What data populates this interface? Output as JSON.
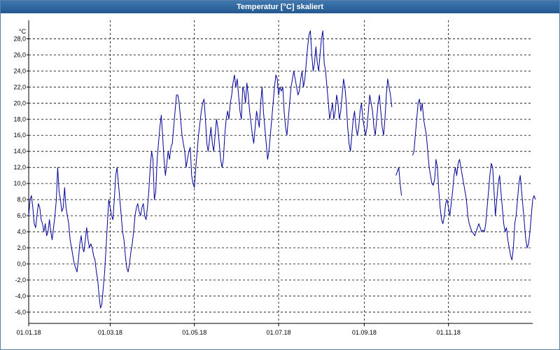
{
  "window": {
    "title": "Temperatur [°C] skaliert"
  },
  "chart_data": {
    "type": "line",
    "title": "Temperatur [°C] skaliert",
    "ylabel": "°C",
    "xlabel": "",
    "ylim": [
      -7.4,
      30.3
    ],
    "xlim": [
      0,
      365
    ],
    "grid": true,
    "legend": "none",
    "y_ticks": [
      "-6,0",
      "-4,0",
      "-2,0",
      "0,0",
      "2,0",
      "4,0",
      "6,0",
      "8,0",
      "10,0",
      "12,0",
      "14,0",
      "16,0",
      "18,0",
      "20,0",
      "22,0",
      "24,0",
      "26,0",
      "28,0"
    ],
    "x_ticks": [
      "01.01.18",
      "01.03.18",
      "01.05.18",
      "01.07.18",
      "01.09.18",
      "01.11.18"
    ],
    "series": [
      {
        "color": "#000099",
        "segments": [
          {
            "x_start": "01.01.18",
            "values": [
              6.0,
              8.0,
              8.5,
              7.0,
              5.0,
              4.5,
              6.0,
              7.5,
              7.0,
              5.5,
              5.0,
              4.0,
              5.0,
              3.5,
              4.0,
              5.5,
              4.0,
              3.0,
              4.5,
              6.0,
              8.0,
              12.0,
              9.0,
              8.0,
              6.5,
              7.0,
              9.5,
              7.0,
              6.0,
              5.0,
              3.0,
              2.0,
              1.0,
              0.0,
              -0.5,
              -1.0,
              0.5,
              2.5,
              3.5,
              2.0,
              1.5,
              3.0,
              4.5,
              3.0,
              2.0,
              2.5,
              2.0,
              1.0,
              0.5,
              -1.0,
              -2.0,
              -4.0,
              -5.5,
              -5.0,
              -3.0,
              -1.0,
              2.0,
              5.0,
              8.0,
              7.0,
              6.0,
              5.5,
              8.0,
              11.0,
              12.0,
              10.0,
              8.0,
              6.0,
              4.0,
              3.0,
              1.0,
              -0.5,
              -1.0,
              0.0,
              1.5,
              2.5,
              4.0,
              6.0,
              7.0,
              7.5,
              6.5,
              6.0,
              7.0,
              7.5,
              6.0,
              5.5,
              7.0,
              9.0,
              12.0,
              14.0,
              13.0,
              8.0,
              9.0,
              13.0,
              15.0,
              17.0,
              18.5,
              16.0,
              13.0,
              11.0,
              12.5,
              14.0,
              13.0,
              14.5,
              15.0,
              17.0,
              19.0,
              21.0,
              21.0,
              20.0,
              18.0,
              16.0,
              15.0,
              14.0,
              12.0,
              13.0,
              14.0,
              14.5,
              11.0,
              10.0,
              9.5,
              12.0,
              14.0,
              16.0,
              17.5,
              19.0,
              20.0,
              20.5,
              18.0,
              15.0,
              14.0,
              15.5,
              17.0,
              15.0,
              14.0,
              16.0,
              18.0,
              17.0,
              15.0,
              13.0,
              12.0,
              13.0,
              16.0,
              18.0,
              19.0,
              18.0,
              20.0,
              21.0,
              22.5,
              23.5,
              22.0,
              23.0,
              21.0,
              19.0,
              18.0,
              22.0,
              21.5,
              20.0,
              22.5,
              21.0,
              19.0,
              17.5,
              16.0,
              15.0,
              17.0,
              19.0,
              18.0,
              17.0,
              20.0,
              22.0,
              19.0,
              17.0,
              15.0,
              13.0,
              14.0,
              16.0,
              18.0,
              20.0,
              22.0,
              23.5,
              23.0,
              21.0,
              22.0,
              21.5,
              22.0,
              19.0,
              17.0,
              16.0,
              18.0,
              20.0,
              22.0,
              23.0,
              24.0,
              23.0,
              22.0,
              21.0,
              21.5,
              23.0,
              24.0,
              22.0,
              23.0,
              25.0,
              27.0,
              28.5,
              29.0,
              26.0,
              24.0,
              25.0,
              27.0,
              25.0,
              24.0,
              26.0,
              28.0,
              29.0,
              25.0,
              24.0,
              22.0,
              20.0,
              18.0,
              19.0,
              20.0,
              18.0,
              19.0,
              21.0,
              20.0,
              18.0,
              19.0,
              21.0,
              23.0,
              22.0,
              20.0,
              17.0,
              15.0,
              14.0,
              16.0,
              18.0,
              19.0,
              17.0,
              16.0,
              17.0,
              19.0,
              20.0,
              18.0,
              17.0,
              16.0,
              17.0,
              19.0,
              21.0,
              20.0,
              19.0,
              17.0,
              16.0,
              18.0,
              20.0,
              21.0,
              19.0,
              17.0,
              16.0,
              18.0,
              21.0,
              23.0,
              22.0,
              21.0,
              19.5
            ]
          },
          {
            "x_start": "24.09.18",
            "values": [
              11.0,
              11.5,
              12.0,
              10.0,
              8.5
            ]
          },
          {
            "x_start": "06.10.18",
            "values": [
              13.5,
              14.0,
              16.0,
              18.0,
              20.0,
              20.5,
              19.0,
              20.0,
              18.0,
              17.0,
              16.0,
              14.0,
              12.0,
              11.0,
              10.0,
              9.8,
              10.5,
              13.0,
              12.0,
              9.0,
              7.0,
              5.5,
              5.0,
              6.0,
              7.5,
              8.0,
              7.0,
              6.0,
              7.5,
              9.0,
              11.0,
              12.0,
              11.0,
              12.5,
              13.0,
              12.0,
              11.0,
              10.0,
              9.0,
              8.0,
              6.0,
              5.0,
              4.5,
              4.0,
              3.8,
              3.5,
              4.0,
              4.5,
              5.0,
              4.5,
              4.0,
              4.2,
              4.0,
              5.0,
              7.0,
              9.0,
              11.0,
              12.5,
              12.0,
              9.0,
              6.0,
              8.0,
              10.0,
              11.0,
              9.0,
              7.0,
              5.0,
              4.0,
              4.5,
              3.0,
              2.0,
              1.0,
              0.5,
              2.0,
              5.0,
              6.0,
              8.0,
              10.0,
              11.0,
              9.0,
              7.0,
              5.0,
              3.0,
              2.0,
              2.5,
              4.0,
              6.0,
              8.0,
              8.5,
              8.0
            ]
          }
        ]
      }
    ]
  }
}
